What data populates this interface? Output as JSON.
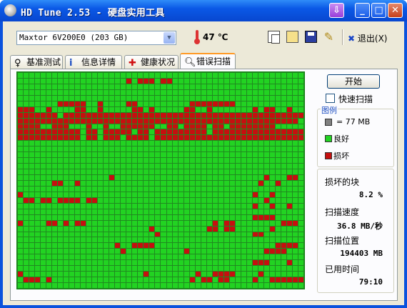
{
  "window": {
    "title": "HD Tune 2.53 - 硬盘实用工具",
    "controls": {
      "down": "⇩",
      "minimize": "_",
      "maximize": "□",
      "close": "✕"
    }
  },
  "toolbar": {
    "drive": "Maxtor 6V200E0 (203 GB)",
    "temperature": "47 ℃",
    "icons": [
      "copy-icon",
      "copy-screen-icon",
      "save-icon",
      "options-key-icon"
    ],
    "exit_label": "退出(X)"
  },
  "tabs": [
    {
      "label": "基准测试",
      "icon": "benchmark-icon"
    },
    {
      "label": "信息详情",
      "icon": "info-icon"
    },
    {
      "label": "健康状况",
      "icon": "health-icon"
    },
    {
      "label": "错误扫描",
      "icon": "search-icon",
      "active": true
    }
  ],
  "scan": {
    "start_label": "开始",
    "quick_scan_label": "快速扫描",
    "quick_scan_checked": false,
    "legend": {
      "title": "图例",
      "block_size": "= 77 MB",
      "good": "良好",
      "bad": "损坏"
    },
    "stats": {
      "damaged_label": "损坏的块",
      "damaged_value": "8.2 %",
      "speed_label": "扫描速度",
      "speed_value": "36.8 MB/秒",
      "position_label": "扫描位置",
      "position_value": "194403 MB",
      "elapsed_label": "已用时间",
      "elapsed_value": "79:10"
    },
    "colors": {
      "good": "#22d322",
      "bad": "#c60f0f",
      "unscanned": "#808080"
    },
    "grid_columns": 50,
    "grid_rows": 38,
    "bad_blocks": {
      "0": [],
      "1": [
        19,
        21,
        22,
        23,
        25,
        26
      ],
      "2": [],
      "3": [],
      "4": [],
      "5": [
        7,
        8,
        9,
        10,
        11,
        14,
        19,
        20,
        30,
        31,
        32,
        33,
        34,
        35,
        36,
        37
      ],
      "6": [
        0,
        1,
        2,
        5,
        10,
        11,
        14,
        20,
        21,
        23,
        29,
        30,
        33,
        41,
        43,
        44,
        47
      ],
      "7": [
        0,
        1,
        2,
        3,
        4,
        5,
        6,
        8,
        9,
        10,
        11,
        12,
        13,
        14,
        15,
        16,
        17,
        18,
        19,
        20,
        21,
        22,
        23,
        24,
        25,
        26,
        27,
        28,
        29,
        30,
        31,
        32,
        33,
        34,
        35,
        36,
        37,
        38,
        39,
        40,
        41,
        42,
        43,
        44,
        45,
        46,
        47,
        48,
        49
      ],
      "8": [
        0,
        1,
        2,
        3,
        4,
        5,
        6,
        7,
        8,
        9,
        10,
        11,
        12,
        13,
        14,
        15,
        16,
        17,
        18,
        19,
        20,
        21,
        22,
        23,
        24,
        25,
        26,
        27,
        28,
        29,
        30,
        31,
        32,
        33,
        34,
        35,
        36,
        37,
        38,
        39,
        40,
        41,
        42,
        43,
        44,
        45,
        46,
        47,
        48
      ],
      "9": [
        0,
        1,
        2,
        3,
        6,
        7,
        8,
        12,
        15,
        18,
        19,
        20,
        21,
        22,
        23,
        26,
        27,
        29,
        30,
        31,
        32,
        34,
        35,
        37,
        38,
        39,
        40,
        41,
        42,
        43,
        44
      ],
      "10": [
        0,
        1,
        2,
        3,
        4,
        5,
        6,
        7,
        8,
        9,
        10,
        12,
        13,
        15,
        16,
        17,
        18,
        19,
        21,
        22,
        24,
        25,
        26,
        27,
        28,
        29,
        30,
        31,
        32,
        34,
        35,
        36,
        37,
        38,
        39,
        40,
        41,
        42,
        43,
        44,
        45,
        46,
        47,
        48,
        49
      ],
      "11": [
        0,
        1,
        2,
        3,
        4,
        5,
        6,
        7,
        8,
        9,
        10,
        12,
        13,
        15,
        16,
        17,
        19,
        20,
        21,
        22,
        24,
        25,
        26,
        27,
        28,
        29,
        30,
        31,
        32,
        33,
        34,
        35,
        36,
        37,
        38,
        39,
        40,
        41,
        42,
        43,
        44,
        45,
        46,
        47,
        48,
        49
      ],
      "12": [],
      "13": [],
      "14": [],
      "15": [],
      "16": [],
      "17": [],
      "18": [
        16,
        43,
        47,
        48
      ],
      "19": [
        6,
        7,
        10,
        42,
        45
      ],
      "20": [],
      "21": [
        0,
        41,
        44
      ],
      "22": [
        1,
        2,
        4,
        5,
        7,
        8,
        9,
        10,
        12,
        13,
        43
      ],
      "23": [
        41,
        44,
        47
      ],
      "24": [],
      "25": [
        41,
        42,
        43,
        44
      ],
      "26": [
        0,
        5,
        6,
        8,
        10,
        11,
        34,
        36,
        37,
        46,
        47,
        48
      ],
      "27": [
        23,
        33,
        34,
        36,
        37,
        44
      ],
      "28": [
        24,
        41,
        42
      ],
      "29": [],
      "30": [
        17,
        20,
        21,
        22,
        23,
        45,
        46,
        47,
        48
      ],
      "31": [
        18,
        29,
        43,
        44,
        45,
        46
      ],
      "32": [],
      "33": [
        41,
        42,
        43,
        47
      ],
      "34": [],
      "35": [
        0,
        22,
        31,
        34,
        35,
        36,
        37,
        42
      ],
      "36": [
        1,
        2,
        3,
        5,
        30,
        32,
        33,
        35,
        36,
        41,
        44,
        45,
        46,
        47,
        48,
        49
      ]
    }
  }
}
